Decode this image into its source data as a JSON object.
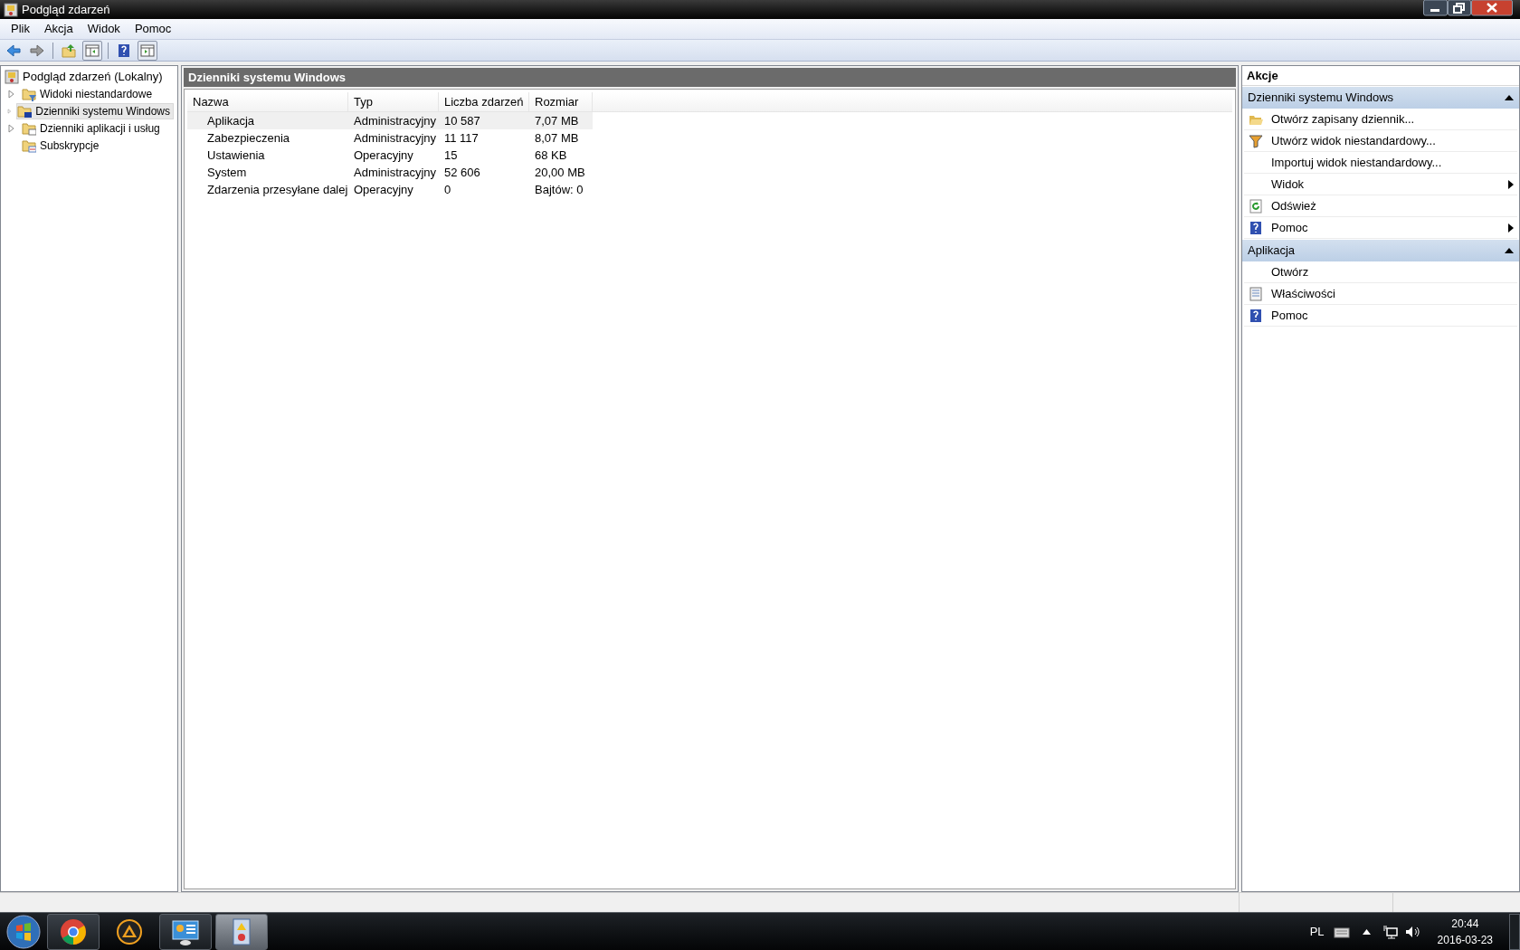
{
  "window": {
    "title": "Podgląd zdarzeń"
  },
  "menu": [
    {
      "label": "Plik"
    },
    {
      "label": "Akcja"
    },
    {
      "label": "Widok"
    },
    {
      "label": "Pomoc"
    }
  ],
  "toolbar": [
    {
      "kind": "back"
    },
    {
      "kind": "forward"
    },
    {
      "kind": "separator"
    },
    {
      "kind": "up"
    },
    {
      "kind": "tree-pane"
    },
    {
      "kind": "separator"
    },
    {
      "kind": "help"
    },
    {
      "kind": "action-pane"
    }
  ],
  "tree": {
    "label": "Podgląd zdarzeń (Lokalny)",
    "selected": false,
    "children": [
      {
        "label": "Widoki niestandardowe",
        "kind": "filter-folder",
        "expandable": true,
        "selected": false
      },
      {
        "label": "Dzienniki systemu Windows",
        "kind": "windows-folder",
        "expandable": true,
        "selected": true
      },
      {
        "label": "Dzienniki aplikacji i usług",
        "kind": "doc-folder",
        "expandable": true,
        "selected": false
      },
      {
        "label": "Subskrypcje",
        "kind": "calendar-folder",
        "expandable": false,
        "selected": false
      }
    ]
  },
  "center": {
    "title": "Dzienniki systemu Windows",
    "columns": [
      "Nazwa",
      "Typ",
      "Liczba zdarzeń",
      "Rozmiar"
    ],
    "rows": [
      {
        "cells": [
          "Aplikacja",
          "Administracyjny",
          "10 587",
          "7,07 MB"
        ],
        "selected": true
      },
      {
        "cells": [
          "Zabezpieczenia",
          "Administracyjny",
          "11 117",
          "8,07 MB"
        ],
        "selected": false
      },
      {
        "cells": [
          "Ustawienia",
          "Operacyjny",
          "15",
          "68 KB"
        ],
        "selected": false
      },
      {
        "cells": [
          "System",
          "Administracyjny",
          "52 606",
          "20,00 MB"
        ],
        "selected": false
      },
      {
        "cells": [
          "Zdarzenia przesyłane dalej",
          "Operacyjny",
          "0",
          "Bajtów: 0"
        ],
        "selected": false
      }
    ]
  },
  "actions": {
    "title": "Akcje",
    "sections": [
      {
        "title": "Dzienniki systemu Windows",
        "expanded": true,
        "items": [
          {
            "label": "Otwórz zapisany dziennik...",
            "kind": "open-folder",
            "submenu": false
          },
          {
            "label": "Utwórz widok niestandardowy...",
            "kind": "filter",
            "submenu": false
          },
          {
            "label": "Importuj widok niestandardowy...",
            "kind": "plain",
            "submenu": false
          },
          {
            "label": "Widok",
            "kind": "plain",
            "submenu": true
          },
          {
            "label": "Odśwież",
            "kind": "refresh",
            "submenu": false
          },
          {
            "label": "Pomoc",
            "kind": "help",
            "submenu": true
          }
        ]
      },
      {
        "title": "Aplikacja",
        "expanded": true,
        "items": [
          {
            "label": "Otwórz",
            "kind": "plain",
            "submenu": false
          },
          {
            "label": "Właściwości",
            "kind": "properties",
            "submenu": false
          },
          {
            "label": "Pomoc",
            "kind": "help",
            "submenu": false
          }
        ]
      }
    ]
  },
  "taskbar": {
    "apps": [
      {
        "kind": "browser",
        "running": true,
        "active": false
      },
      {
        "kind": "player",
        "running": false,
        "active": false
      },
      {
        "kind": "control-panel",
        "running": true,
        "active": false
      },
      {
        "kind": "event-viewer",
        "running": true,
        "active": true
      }
    ],
    "language": "PL",
    "time": "20:44",
    "date": "2016-03-23"
  }
}
